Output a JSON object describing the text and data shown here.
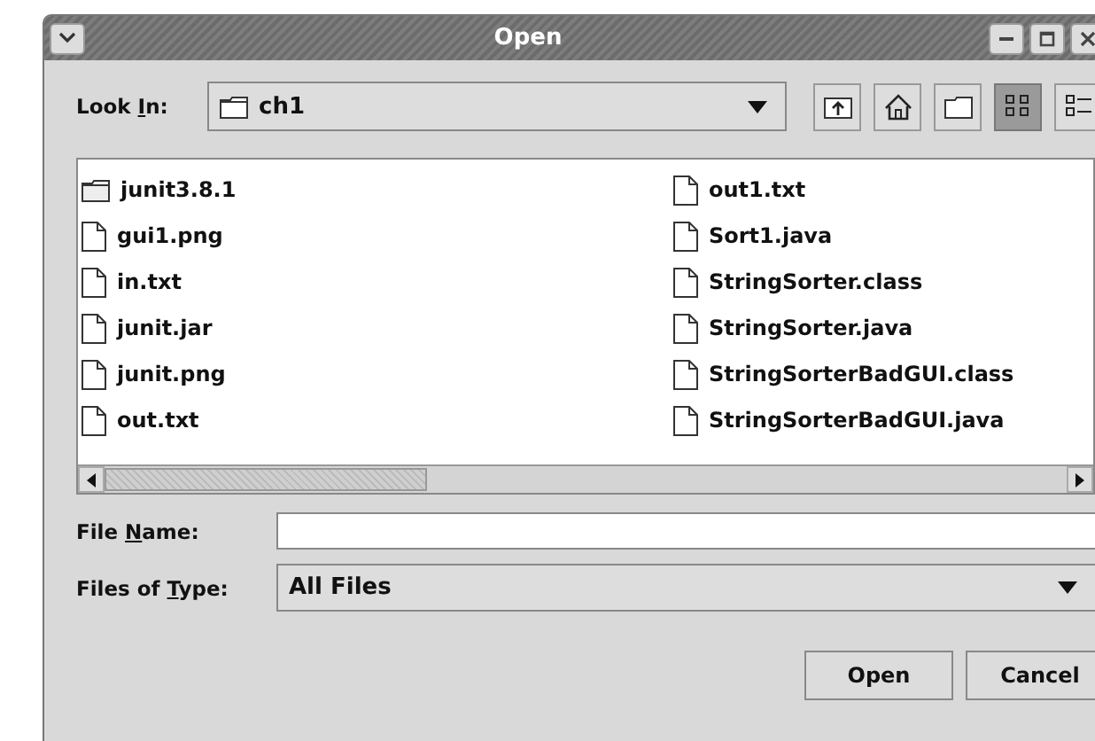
{
  "window": {
    "title": "Open"
  },
  "look_in": {
    "label_parts": [
      "Look ",
      "I",
      "n:"
    ],
    "value": "ch1"
  },
  "view_buttons": [
    {
      "kind": "list",
      "selected": true
    },
    {
      "kind": "details",
      "selected": false
    }
  ],
  "files": [
    {
      "name": "junit3.8.1",
      "kind": "folder"
    },
    {
      "name": "gui1.png",
      "kind": "file"
    },
    {
      "name": "in.txt",
      "kind": "file"
    },
    {
      "name": "junit.jar",
      "kind": "file"
    },
    {
      "name": "junit.png",
      "kind": "file"
    },
    {
      "name": "out.txt",
      "kind": "file"
    },
    {
      "name": "out1.txt",
      "kind": "file"
    },
    {
      "name": "Sort1.java",
      "kind": "file"
    },
    {
      "name": "StringSorter.class",
      "kind": "file"
    },
    {
      "name": "StringSorter.java",
      "kind": "file"
    },
    {
      "name": "StringSorterBadGUI.class",
      "kind": "file"
    },
    {
      "name": "StringSorterBadGUI.java",
      "kind": "file"
    }
  ],
  "file_name": {
    "label_parts": [
      "File ",
      "N",
      "ame:"
    ]
  },
  "files_of_type": {
    "label_parts": [
      "Files of ",
      "T",
      "ype:"
    ],
    "value": "All Files"
  },
  "buttons": [
    "Open",
    "Cancel"
  ]
}
